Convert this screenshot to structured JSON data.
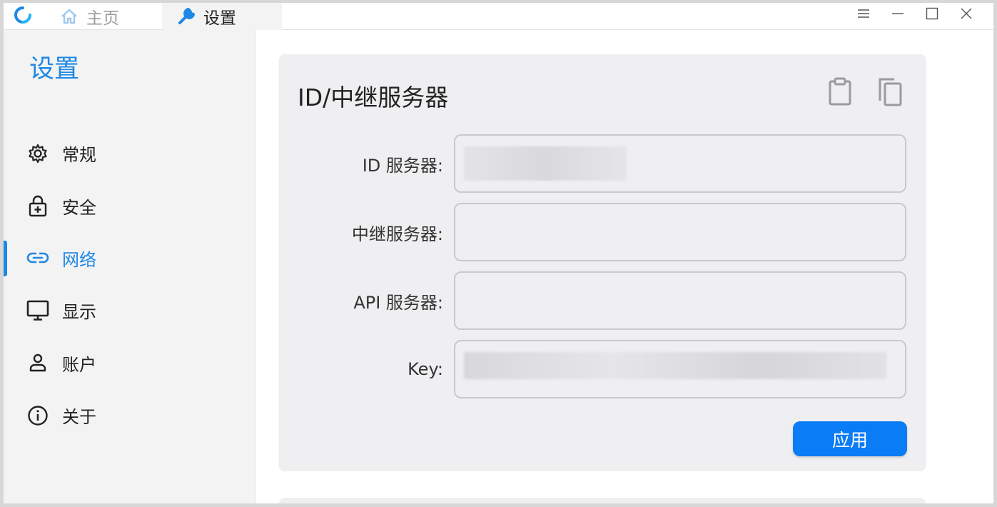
{
  "titlebar": {
    "tabs": [
      {
        "label": "主页",
        "icon": "home-icon"
      },
      {
        "label": "设置",
        "icon": "wrench-icon"
      }
    ],
    "controls": [
      "menu-icon",
      "minimize-icon",
      "maximize-icon",
      "close-icon"
    ]
  },
  "sidebar": {
    "title": "设置",
    "items": [
      {
        "label": "常规",
        "icon": "gear-icon",
        "active": false
      },
      {
        "label": "安全",
        "icon": "lock-icon",
        "active": false
      },
      {
        "label": "网络",
        "icon": "link-icon",
        "active": true
      },
      {
        "label": "显示",
        "icon": "monitor-icon",
        "active": false
      },
      {
        "label": "账户",
        "icon": "person-icon",
        "active": false
      },
      {
        "label": "关于",
        "icon": "info-icon",
        "active": false
      }
    ]
  },
  "card": {
    "title": "ID/中继服务器",
    "icons": [
      "clipboard-icon",
      "copy-icon"
    ],
    "fields": [
      {
        "label": "ID 服务器:",
        "value": "",
        "redacted": true
      },
      {
        "label": "中继服务器:",
        "value": ""
      },
      {
        "label": "API 服务器:",
        "value": ""
      },
      {
        "label": "Key:",
        "value": "",
        "redacted": true
      }
    ],
    "apply_label": "应用"
  },
  "colors": {
    "accent": "#1e88e5",
    "button": "#0a7cf5",
    "card_bg": "#efeff1",
    "sidebar_bg": "#f3f3f4"
  }
}
